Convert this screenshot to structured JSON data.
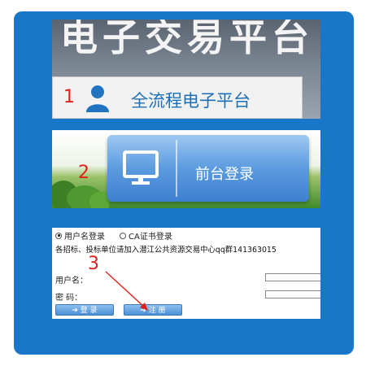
{
  "panel1": {
    "banner_text": "电子交易平台",
    "button_label": "全流程电子平台",
    "step": "1"
  },
  "panel2": {
    "button_label": "前台登录",
    "step": "2"
  },
  "panel3": {
    "radio_user": "用户名登录",
    "radio_ca": "CA证书登录",
    "notice": "各招标、投标单位请加入潜江公共资源交易中心qq群141363015",
    "username_label": "用户名：",
    "password_label": "密  码：",
    "login_button": "登 录",
    "register_button": "注 册",
    "step": "3"
  },
  "colors": {
    "frame": "#1877c9",
    "step_number": "#e0201a",
    "arrow": "#e0201a"
  }
}
